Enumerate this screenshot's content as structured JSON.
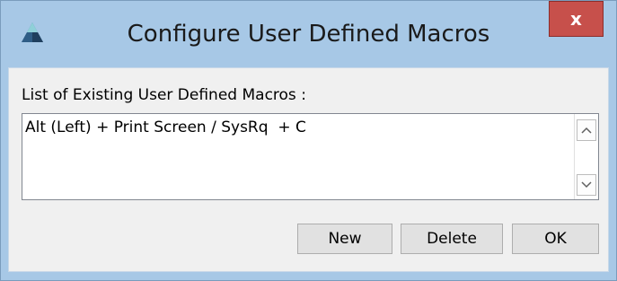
{
  "window": {
    "title": "Configure User Defined Macros",
    "close_label": "x",
    "app_icon": "app-triangle-icon",
    "colors": {
      "frame": "#a7c8e6",
      "close_button": "#c7504b",
      "client_background": "#f0f0f0"
    }
  },
  "dialog": {
    "list_label": "List of Existing User Defined Macros :",
    "macros": [
      "Alt (Left) + Print Screen / SysRq  + C"
    ],
    "scroll_up_icon": "chevron-up-icon",
    "scroll_down_icon": "chevron-down-icon"
  },
  "buttons": {
    "new_label": "New",
    "delete_label": "Delete",
    "ok_label": "OK"
  }
}
